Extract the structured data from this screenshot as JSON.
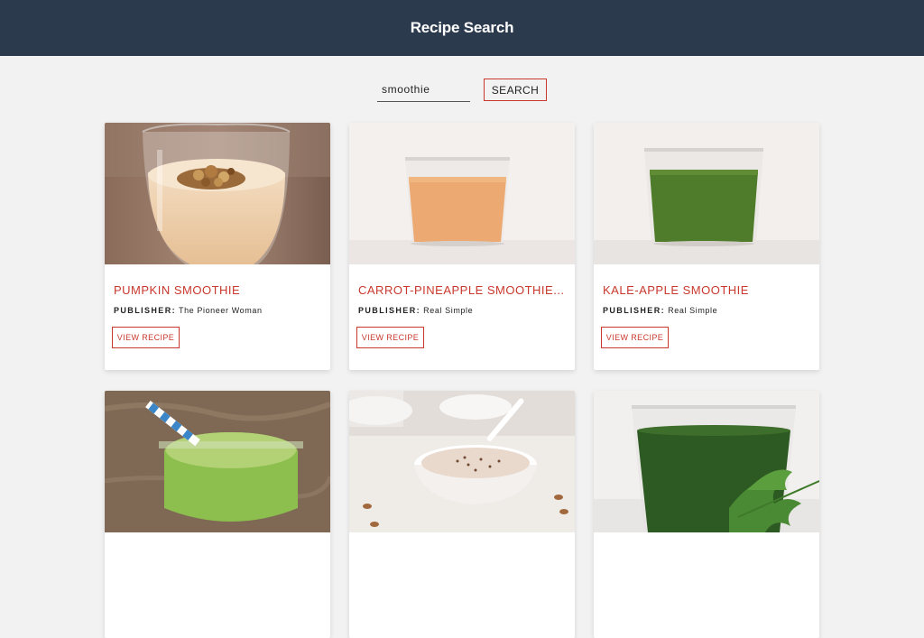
{
  "header": {
    "title": "Recipe Search"
  },
  "search": {
    "value": "smoothie",
    "button_label": "SEARCH"
  },
  "publisher_label": "PUBLISHER:",
  "view_recipe_label": "VIEW RECIPE",
  "recipes": [
    {
      "title": "PUMPKIN SMOOTHIE",
      "publisher": "The Pioneer Woman"
    },
    {
      "title": "CARROT-PINEAPPLE SMOOTHIE...",
      "publisher": "Real Simple"
    },
    {
      "title": "KALE-APPLE SMOOTHIE",
      "publisher": "Real Simple"
    },
    {
      "title": "",
      "publisher": ""
    },
    {
      "title": "",
      "publisher": ""
    },
    {
      "title": "",
      "publisher": ""
    }
  ],
  "colors": {
    "header_bg": "#2c3a4d",
    "accent": "#c9382c",
    "page_bg": "#f2f2f2"
  }
}
